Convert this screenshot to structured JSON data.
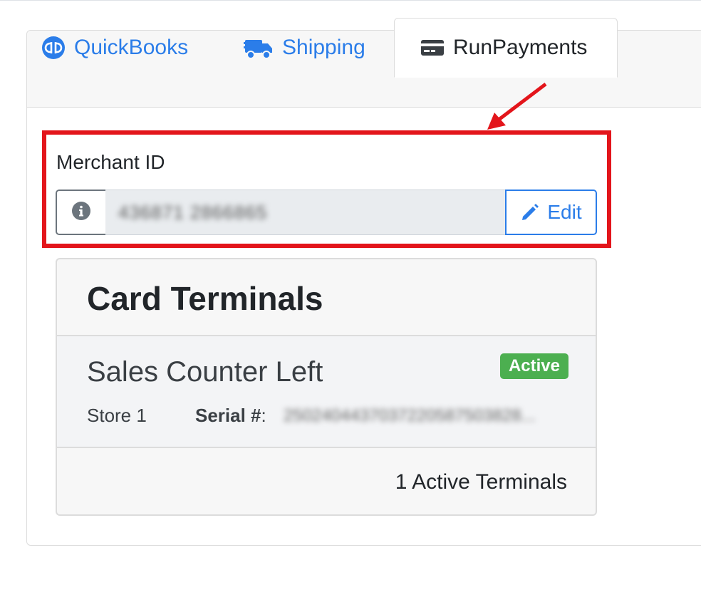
{
  "tabs": [
    {
      "label": "QuickBooks",
      "icon": "quickbooks-icon"
    },
    {
      "label": "Shipping",
      "icon": "truck-icon"
    },
    {
      "label": "RunPayments",
      "icon": "credit-card-icon",
      "active": true
    }
  ],
  "merchant": {
    "label": "Merchant ID",
    "value": "436871 2866865",
    "info_icon": "info-icon",
    "edit_label": "Edit",
    "edit_icon": "pencil-icon"
  },
  "terminals": {
    "title": "Card Terminals",
    "items": [
      {
        "name": "Sales Counter Left",
        "status": "Active",
        "store": "Store 1",
        "serial_label": "Serial #",
        "serial_colon": ":",
        "serial_value": "2502404437037220587503828..."
      }
    ],
    "footer": "1 Active Terminals"
  },
  "colors": {
    "accent": "#2b7de9",
    "highlight": "#e3151b",
    "status_active": "#4caf50"
  }
}
